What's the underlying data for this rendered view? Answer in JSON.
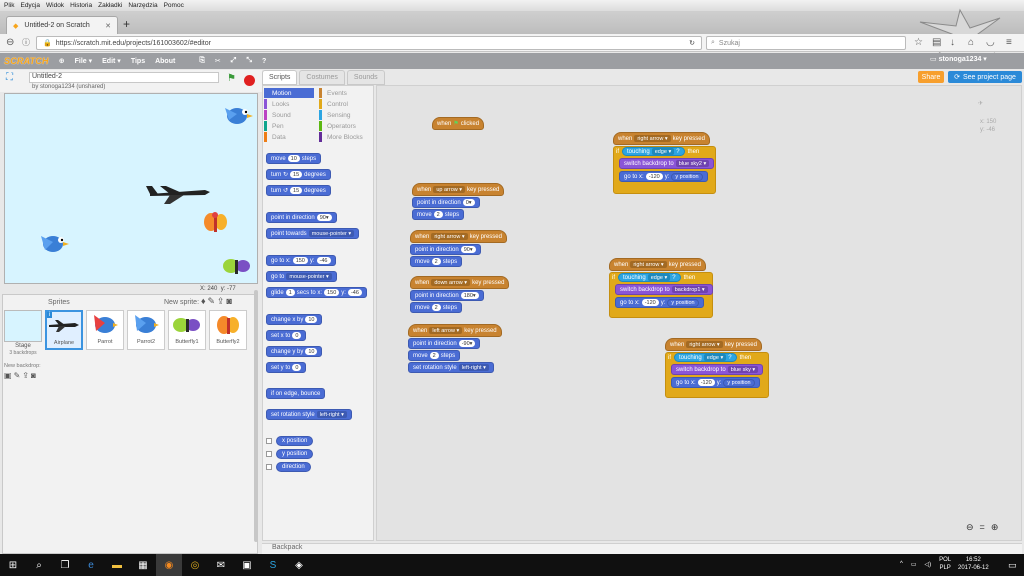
{
  "browser": {
    "menu": [
      "Plik",
      "Edycja",
      "Widok",
      "Historia",
      "Zakładki",
      "Narzędzia",
      "Pomoc"
    ],
    "tab_title": "Untitled-2 on Scratch",
    "url": "https://scratch.mit.edu/projects/161003602/#editor",
    "search_placeholder": "Szukaj"
  },
  "scratch": {
    "menu": [
      "File ▾",
      "Edit ▾",
      "Tips",
      "About"
    ],
    "user": "stonoga1234",
    "project_title": "Untitled-2",
    "byline": "by stonoga1234 (unshared)",
    "tabs": [
      "Scripts",
      "Costumes",
      "Sounds"
    ],
    "share": "Share",
    "see_project": "See project page",
    "coords": {
      "x_label": "X:",
      "x": "240",
      "y_label": "y:",
      "y": "-77"
    },
    "sprites_label": "Sprites",
    "new_sprite": "New sprite:",
    "stage_label": "Stage",
    "stage_sub": "3 backdrops",
    "new_backdrop": "New backdrop:",
    "sprites": [
      "Airplane",
      "Parrot",
      "Parrot2",
      "Butterfly1",
      "Butterfly2"
    ],
    "categories_left": [
      "Motion",
      "Looks",
      "Sound",
      "Pen",
      "Data"
    ],
    "categories_right": [
      "Events",
      "Control",
      "Sensing",
      "Operators",
      "More Blocks"
    ],
    "category_colors": [
      "#4a6cd4",
      "#8a55d7",
      "#bb42c3",
      "#0fa58c",
      "#ee7d16",
      "#c88330",
      "#e1a91a",
      "#2ca5e2",
      "#5cb712",
      "#632d99"
    ],
    "ghost_xy": [
      "x: 150",
      "y: -46"
    ],
    "backpack": "Backpack"
  },
  "palette": {
    "move": [
      "move",
      "10",
      "steps"
    ],
    "turn_r": [
      "turn ↻",
      "15",
      "degrees"
    ],
    "turn_l": [
      "turn ↺",
      "15",
      "degrees"
    ],
    "point_dir": [
      "point in direction",
      "90▾"
    ],
    "point_towards": [
      "point towards",
      "mouse-pointer ▾"
    ],
    "goto_xy": [
      "go to x:",
      "150",
      "y:",
      "-46"
    ],
    "goto": [
      "go to",
      "mouse-pointer ▾"
    ],
    "glide": [
      "glide",
      "1",
      "secs to x:",
      "150",
      "y:",
      "-46"
    ],
    "change_x": [
      "change x by",
      "10"
    ],
    "set_x": [
      "set x to",
      "0"
    ],
    "change_y": [
      "change y by",
      "10"
    ],
    "set_y": [
      "set y to",
      "0"
    ],
    "bounce": "if on edge, bounce",
    "rotation": [
      "set rotation style",
      "left-right ▾"
    ],
    "reporters": [
      "x position",
      "y position",
      "direction"
    ]
  },
  "scripts": {
    "flag_hat": [
      "when",
      "clicked"
    ],
    "s_up": {
      "hat": [
        "when",
        "up arrow ▾",
        "key pressed"
      ],
      "dir": [
        "point in direction",
        "0▾"
      ],
      "move": [
        "move",
        "2",
        "steps"
      ]
    },
    "s_right": {
      "hat": [
        "when",
        "right arrow ▾",
        "key pressed"
      ],
      "dir": [
        "point in direction",
        "90▾"
      ],
      "move": [
        "move",
        "2",
        "steps"
      ]
    },
    "s_down": {
      "hat": [
        "when",
        "down arrow ▾",
        "key pressed"
      ],
      "dir": [
        "point in direction",
        "180▾"
      ],
      "move": [
        "move",
        "2",
        "steps"
      ]
    },
    "s_left": {
      "hat": [
        "when",
        "left arrow ▾",
        "key pressed"
      ],
      "dir": [
        "point in direction",
        "-90▾"
      ],
      "move": [
        "move",
        "2",
        "steps"
      ],
      "rot": [
        "set rotation style",
        "left-right ▾"
      ]
    },
    "ifs": [
      {
        "hat": [
          "when",
          "right arrow ▾",
          "key pressed"
        ],
        "if": [
          "if",
          "touching",
          "edge ▾",
          "?",
          "then"
        ],
        "bd": [
          "switch backdrop to",
          "blue sky2 ▾"
        ],
        "go": [
          "go to x:",
          "-120",
          "y:",
          "y position"
        ]
      },
      {
        "hat": [
          "when",
          "right arrow ▾",
          "key pressed"
        ],
        "if": [
          "if",
          "touching",
          "edge ▾",
          "?",
          "then"
        ],
        "bd": [
          "switch backdrop to",
          "backdrop1 ▾"
        ],
        "go": [
          "go to x:",
          "-120",
          "y:",
          "y position"
        ]
      },
      {
        "hat": [
          "when",
          "right arrow ▾",
          "key pressed"
        ],
        "if": [
          "if",
          "touching",
          "edge ▾",
          "?",
          "then"
        ],
        "bd": [
          "switch backdrop to",
          "blue sky ▾"
        ],
        "go": [
          "go to x:",
          "-120",
          "y:",
          "y position"
        ]
      }
    ]
  },
  "taskbar": {
    "lang": "POL",
    "lang2": "PLP",
    "time": "16:52",
    "date": "2017-06-12"
  }
}
